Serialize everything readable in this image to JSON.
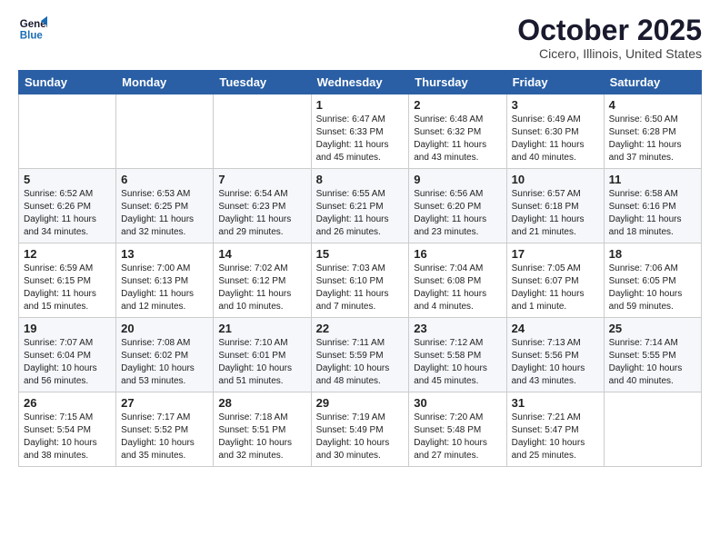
{
  "header": {
    "logo_line1": "General",
    "logo_line2": "Blue",
    "month": "October 2025",
    "location": "Cicero, Illinois, United States"
  },
  "weekdays": [
    "Sunday",
    "Monday",
    "Tuesday",
    "Wednesday",
    "Thursday",
    "Friday",
    "Saturday"
  ],
  "weeks": [
    [
      {
        "day": "",
        "info": ""
      },
      {
        "day": "",
        "info": ""
      },
      {
        "day": "",
        "info": ""
      },
      {
        "day": "1",
        "info": "Sunrise: 6:47 AM\nSunset: 6:33 PM\nDaylight: 11 hours and 45 minutes."
      },
      {
        "day": "2",
        "info": "Sunrise: 6:48 AM\nSunset: 6:32 PM\nDaylight: 11 hours and 43 minutes."
      },
      {
        "day": "3",
        "info": "Sunrise: 6:49 AM\nSunset: 6:30 PM\nDaylight: 11 hours and 40 minutes."
      },
      {
        "day": "4",
        "info": "Sunrise: 6:50 AM\nSunset: 6:28 PM\nDaylight: 11 hours and 37 minutes."
      }
    ],
    [
      {
        "day": "5",
        "info": "Sunrise: 6:52 AM\nSunset: 6:26 PM\nDaylight: 11 hours and 34 minutes."
      },
      {
        "day": "6",
        "info": "Sunrise: 6:53 AM\nSunset: 6:25 PM\nDaylight: 11 hours and 32 minutes."
      },
      {
        "day": "7",
        "info": "Sunrise: 6:54 AM\nSunset: 6:23 PM\nDaylight: 11 hours and 29 minutes."
      },
      {
        "day": "8",
        "info": "Sunrise: 6:55 AM\nSunset: 6:21 PM\nDaylight: 11 hours and 26 minutes."
      },
      {
        "day": "9",
        "info": "Sunrise: 6:56 AM\nSunset: 6:20 PM\nDaylight: 11 hours and 23 minutes."
      },
      {
        "day": "10",
        "info": "Sunrise: 6:57 AM\nSunset: 6:18 PM\nDaylight: 11 hours and 21 minutes."
      },
      {
        "day": "11",
        "info": "Sunrise: 6:58 AM\nSunset: 6:16 PM\nDaylight: 11 hours and 18 minutes."
      }
    ],
    [
      {
        "day": "12",
        "info": "Sunrise: 6:59 AM\nSunset: 6:15 PM\nDaylight: 11 hours and 15 minutes."
      },
      {
        "day": "13",
        "info": "Sunrise: 7:00 AM\nSunset: 6:13 PM\nDaylight: 11 hours and 12 minutes."
      },
      {
        "day": "14",
        "info": "Sunrise: 7:02 AM\nSunset: 6:12 PM\nDaylight: 11 hours and 10 minutes."
      },
      {
        "day": "15",
        "info": "Sunrise: 7:03 AM\nSunset: 6:10 PM\nDaylight: 11 hours and 7 minutes."
      },
      {
        "day": "16",
        "info": "Sunrise: 7:04 AM\nSunset: 6:08 PM\nDaylight: 11 hours and 4 minutes."
      },
      {
        "day": "17",
        "info": "Sunrise: 7:05 AM\nSunset: 6:07 PM\nDaylight: 11 hours and 1 minute."
      },
      {
        "day": "18",
        "info": "Sunrise: 7:06 AM\nSunset: 6:05 PM\nDaylight: 10 hours and 59 minutes."
      }
    ],
    [
      {
        "day": "19",
        "info": "Sunrise: 7:07 AM\nSunset: 6:04 PM\nDaylight: 10 hours and 56 minutes."
      },
      {
        "day": "20",
        "info": "Sunrise: 7:08 AM\nSunset: 6:02 PM\nDaylight: 10 hours and 53 minutes."
      },
      {
        "day": "21",
        "info": "Sunrise: 7:10 AM\nSunset: 6:01 PM\nDaylight: 10 hours and 51 minutes."
      },
      {
        "day": "22",
        "info": "Sunrise: 7:11 AM\nSunset: 5:59 PM\nDaylight: 10 hours and 48 minutes."
      },
      {
        "day": "23",
        "info": "Sunrise: 7:12 AM\nSunset: 5:58 PM\nDaylight: 10 hours and 45 minutes."
      },
      {
        "day": "24",
        "info": "Sunrise: 7:13 AM\nSunset: 5:56 PM\nDaylight: 10 hours and 43 minutes."
      },
      {
        "day": "25",
        "info": "Sunrise: 7:14 AM\nSunset: 5:55 PM\nDaylight: 10 hours and 40 minutes."
      }
    ],
    [
      {
        "day": "26",
        "info": "Sunrise: 7:15 AM\nSunset: 5:54 PM\nDaylight: 10 hours and 38 minutes."
      },
      {
        "day": "27",
        "info": "Sunrise: 7:17 AM\nSunset: 5:52 PM\nDaylight: 10 hours and 35 minutes."
      },
      {
        "day": "28",
        "info": "Sunrise: 7:18 AM\nSunset: 5:51 PM\nDaylight: 10 hours and 32 minutes."
      },
      {
        "day": "29",
        "info": "Sunrise: 7:19 AM\nSunset: 5:49 PM\nDaylight: 10 hours and 30 minutes."
      },
      {
        "day": "30",
        "info": "Sunrise: 7:20 AM\nSunset: 5:48 PM\nDaylight: 10 hours and 27 minutes."
      },
      {
        "day": "31",
        "info": "Sunrise: 7:21 AM\nSunset: 5:47 PM\nDaylight: 10 hours and 25 minutes."
      },
      {
        "day": "",
        "info": ""
      }
    ]
  ]
}
